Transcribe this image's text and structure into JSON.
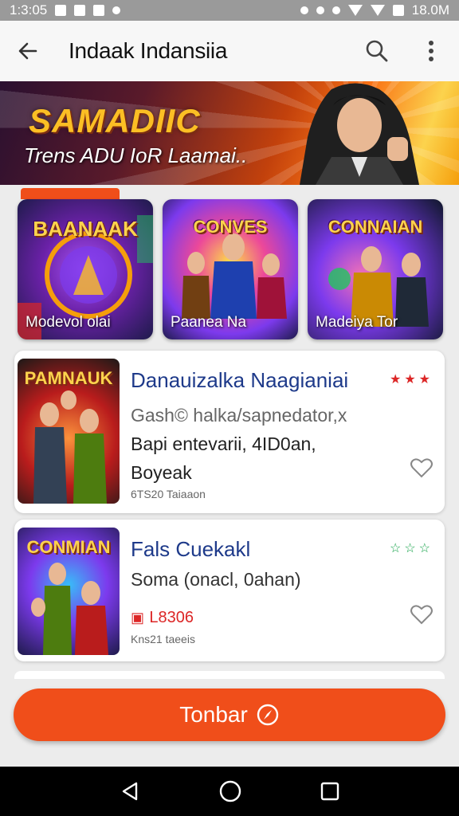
{
  "status_bar": {
    "time": "1:3:05",
    "right_text": "18.0M"
  },
  "app_bar": {
    "title": "Indaak Indansiia"
  },
  "hero": {
    "headline": "SAMADIIC",
    "subline": "Trens ADU IoR Laamai.."
  },
  "game_cards": [
    {
      "art_title": "BAANAAK",
      "label": "Modevol olai"
    },
    {
      "art_title": "CONVES",
      "label": "Paanea Na"
    },
    {
      "art_title": "CONNAIAN",
      "label": "Madeiya Tor"
    }
  ],
  "list": [
    {
      "thumb_title": "PAMNAUK",
      "title": "Danauizalka Naagianiai",
      "line1": "Gash© halka/sapnedator,x",
      "line2": "Bapi entevarii, 4ID0an,",
      "line3": "Boyeak",
      "small": "6TS20 Taiaaon",
      "stars": "★★★",
      "star_color": "#dc2626"
    },
    {
      "thumb_title": "CONMIAN",
      "title": "Fals Cuekakl",
      "line1": "Soma (onacl, 0ahan)",
      "price": "L8306",
      "small": "Kns21 taeeis",
      "stars": "☆☆☆",
      "star_color": "#16a34a"
    }
  ],
  "cta": {
    "label": "Tonbar"
  },
  "colors": {
    "accent": "#f04e1a",
    "title_blue": "#1e3a8a"
  }
}
